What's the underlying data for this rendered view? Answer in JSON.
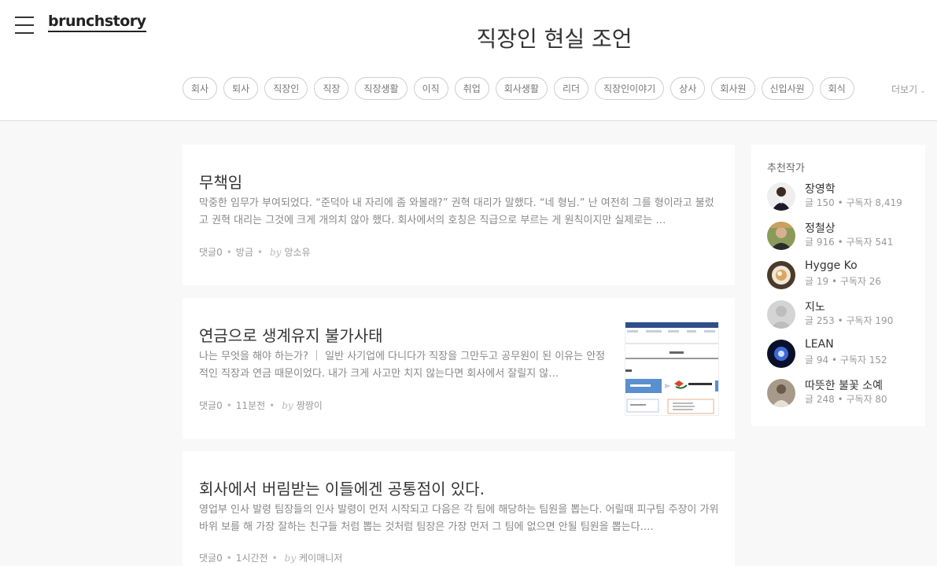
{
  "header": {
    "logo": "brunchstory",
    "title": "직장인 현실 조언",
    "tags": [
      "회사",
      "퇴사",
      "직장인",
      "직장",
      "직장생활",
      "이직",
      "취업",
      "회사생활",
      "리더",
      "직장인이야기",
      "상사",
      "회사원",
      "신입사원",
      "회식"
    ],
    "more_label": "더보기",
    "more_icon": "chevron-down-icon"
  },
  "articles": [
    {
      "title": "무책임",
      "excerpt": "막중한 임무가 부여되었다. “준덕아 내 자리에 좀 와볼래?” 권혁 대리가 말했다. “네 형님.” 난 여전히 그를 형이라고 불렀고 권혁 대리는 그것에 크게 개의치 않아 했다. 회사에서의 호칭은 직급으로 부르는 게 원칙이지만 실제로는 …",
      "comments": "댓글0",
      "time": "방금",
      "by": "by",
      "author": "앙소유"
    },
    {
      "title": "연금으로 생계유지 불가사태",
      "excerpt": "나는 무엇을 해야 하는가? ｜ 일반 사기업에 다니다가 직장을 그만두고 공무원이 된 이유는 안정적인 직장과 연금 때문이었다. 내가 크게 사고만 치지 않는다면 회사에서 잘릴지 않…",
      "comments": "댓글0",
      "time": "11분전",
      "by": "by",
      "author": "짱짱이"
    },
    {
      "title": "회사에서 버림받는 이들에겐 공통점이 있다.",
      "excerpt": "영업부 인사 발령 팀장들의 인사 발령이 먼저 시작되고 다음은 각 팀에 해당하는 팀원을 뽑는다. 어릴때 피구팀 주장이 가위 바위 보를 해 가장 잘하는 친구들 처럼 뽑는 것처럼 팀장은 가장 먼저 그 팀에 없으면 안될 팀원을 뽑는다.…",
      "comments": "댓글0",
      "time": "1시간전",
      "by": "by",
      "author": "케이매니저"
    }
  ],
  "sidebar": {
    "title": "추천작가",
    "writers": [
      {
        "name": "장영학",
        "posts": "글 150",
        "subs": "구독자 8,419"
      },
      {
        "name": "정철상",
        "posts": "글 916",
        "subs": "구독자 541"
      },
      {
        "name": "Hygge Ko",
        "posts": "글 19",
        "subs": "구독자 26"
      },
      {
        "name": "지노",
        "posts": "글 253",
        "subs": "구독자 190"
      },
      {
        "name": "LEAN",
        "posts": "글 94",
        "subs": "구독자 152"
      },
      {
        "name": "따뜻한 불꽃 소예",
        "posts": "글 248",
        "subs": "구독자 80"
      }
    ]
  },
  "colors": {
    "background": "#f8f8f8",
    "card": "#ffffff",
    "text": "#333333",
    "muted": "#999999",
    "tag_border": "#cfcfcf"
  }
}
